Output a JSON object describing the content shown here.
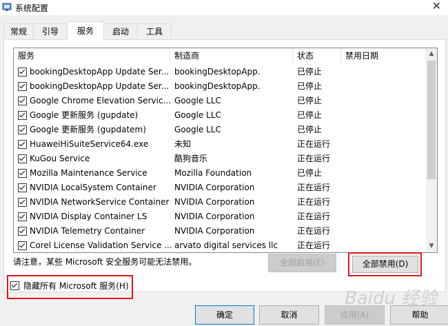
{
  "window": {
    "title": "系统配置"
  },
  "tabs": [
    {
      "label": "常规"
    },
    {
      "label": "引导"
    },
    {
      "label": "服务"
    },
    {
      "label": "启动"
    },
    {
      "label": "工具"
    }
  ],
  "columns": {
    "service": "服务",
    "vendor": "制造商",
    "status": "状态",
    "disabled_date": "禁用日期"
  },
  "services": [
    {
      "name": "bookingDesktopApp Update Ser...",
      "vendor": "bookingDesktopApp.",
      "status": "已停止",
      "checked": true
    },
    {
      "name": "bookingDesktopApp Update Ser...",
      "vendor": "bookingDesktopApp.",
      "status": "已停止",
      "checked": true
    },
    {
      "name": "Google Chrome Elevation Servic...",
      "vendor": "Google LLC",
      "status": "已停止",
      "checked": true
    },
    {
      "name": "Google 更新服务 (gupdate)",
      "vendor": "Google LLC",
      "status": "已停止",
      "checked": true
    },
    {
      "name": "Google 更新服务 (gupdatem)",
      "vendor": "Google LLC",
      "status": "已停止",
      "checked": true
    },
    {
      "name": "HuaweiHiSuiteService64.exe",
      "vendor": "未知",
      "status": "正在运行",
      "checked": true
    },
    {
      "name": "KuGou Service",
      "vendor": "酷狗音乐",
      "status": "正在运行",
      "checked": true
    },
    {
      "name": "Mozilla Maintenance Service",
      "vendor": "Mozilla Foundation",
      "status": "已停止",
      "checked": true
    },
    {
      "name": "NVIDIA LocalSystem Container",
      "vendor": "NVIDIA Corporation",
      "status": "正在运行",
      "checked": true
    },
    {
      "name": "NVIDIA NetworkService Container",
      "vendor": "NVIDIA Corporation",
      "status": "正在运行",
      "checked": true
    },
    {
      "name": "NVIDIA Display Container LS",
      "vendor": "NVIDIA Corporation",
      "status": "正在运行",
      "checked": true
    },
    {
      "name": "NVIDIA Telemetry Container",
      "vendor": "NVIDIA Corporation",
      "status": "正在运行",
      "checked": true
    },
    {
      "name": "Corel License Validation Service ...",
      "vendor": "arvato digital services llc",
      "status": "正在运行",
      "checked": true
    }
  ],
  "note": "请注意，某些 Microsoft 安全服务可能无法禁用。",
  "buttons": {
    "enable_all": "全部启用(E)",
    "disable_all": "全部禁用(D)",
    "ok": "确定",
    "cancel": "取消",
    "apply": "应用(A)",
    "help": "帮助"
  },
  "hide_microsoft": {
    "label": "隐藏所有 Microsoft 服务(H)",
    "checked": true
  },
  "watermark": "Baidu 经验",
  "colors": {
    "highlight_box": "#e8121e",
    "default_button_border": "#0078d7"
  }
}
